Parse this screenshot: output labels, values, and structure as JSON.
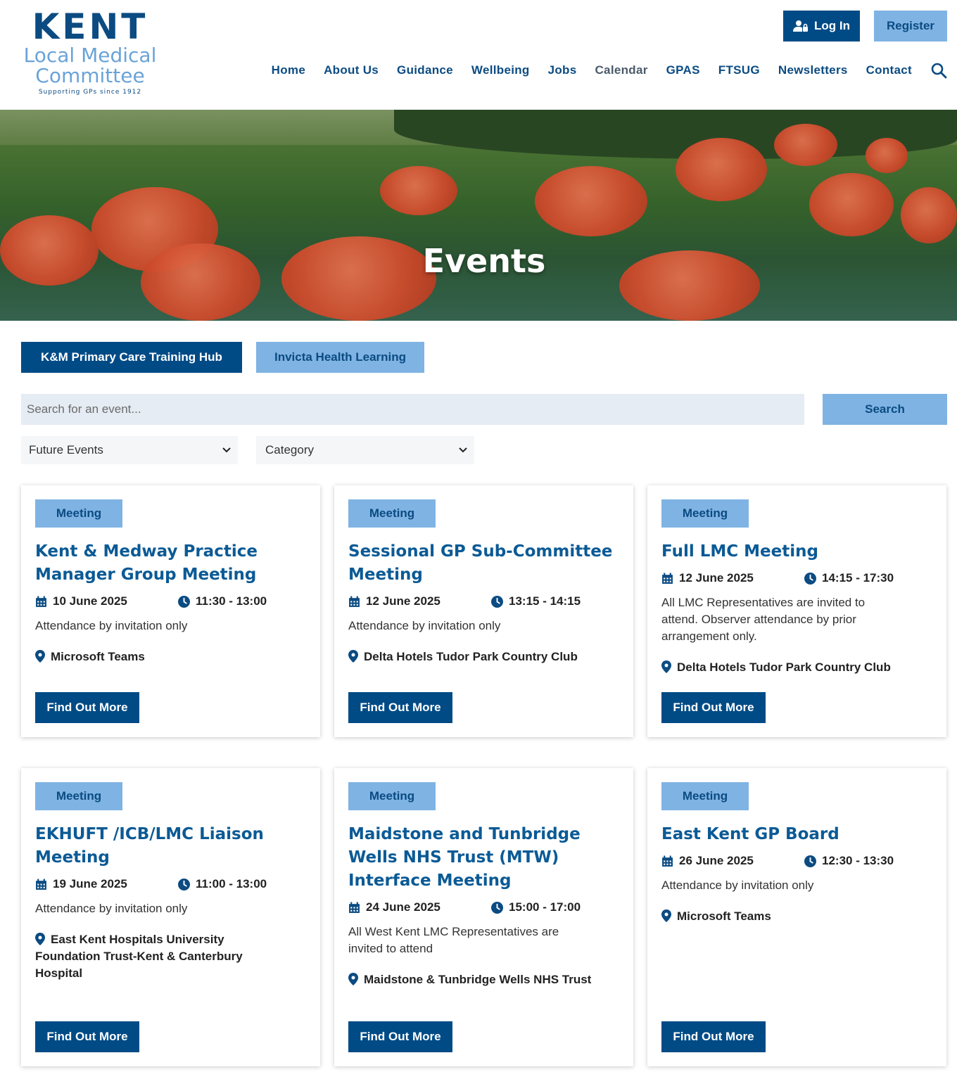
{
  "logo": {
    "line1": "KENT",
    "line2": "Local Medical",
    "line3": "Committee",
    "tagline": "Supporting GPs since 1912"
  },
  "header": {
    "login_label": "Log In",
    "register_label": "Register"
  },
  "nav": [
    "Home",
    "About Us",
    "Guidance",
    "Wellbeing",
    "Jobs",
    "Calendar",
    "GPAS",
    "FTSUG",
    "Newsletters",
    "Contact"
  ],
  "hero": {
    "title": "Events"
  },
  "filters": {
    "hub_label": "K&M Primary Care Training Hub",
    "invicta_label": "Invicta Health Learning",
    "search_placeholder": "Search for an event...",
    "search_button": "Search",
    "when_selected": "Future Events",
    "category_selected": "Category"
  },
  "colors": {
    "primary": "#004b86",
    "accent": "#7fb3e3",
    "title": "#0b5a95",
    "input_bg": "#e5ecf3"
  },
  "events": [
    {
      "category": "Meeting",
      "title": "Kent & Medway Practice Manager Group Meeting",
      "date": "10 June 2025",
      "time": "11:30 - 13:00",
      "description": "Attendance by invitation only",
      "location": "Microsoft Teams",
      "cta": "Find Out More"
    },
    {
      "category": "Meeting",
      "title": "Sessional GP Sub-Committee Meeting",
      "date": "12 June 2025",
      "time": "13:15 - 14:15",
      "description": "Attendance by invitation only",
      "location": "Delta Hotels Tudor Park Country Club",
      "cta": "Find Out More"
    },
    {
      "category": "Meeting",
      "title": "Full LMC Meeting",
      "date": "12 June 2025",
      "time": "14:15 - 17:30",
      "description": "All LMC Representatives are invited to attend. Observer attendance by prior arrangement only.",
      "location": "Delta Hotels Tudor Park Country Club",
      "cta": "Find Out More"
    },
    {
      "category": "Meeting",
      "title": "EKHUFT /ICB/LMC Liaison Meeting",
      "date": "19 June 2025",
      "time": "11:00 - 13:00",
      "description": "Attendance by invitation only",
      "location": "East Kent Hospitals University Foundation Trust-Kent & Canterbury Hospital",
      "cta": "Find Out More"
    },
    {
      "category": "Meeting",
      "title": "Maidstone and Tunbridge Wells NHS Trust (MTW) Interface Meeting",
      "date": "24 June 2025",
      "time": "15:00 - 17:00",
      "description": "All West Kent LMC Representatives are invited to attend",
      "location": "Maidstone & Tunbridge Wells NHS Trust",
      "cta": "Find Out More"
    },
    {
      "category": "Meeting",
      "title": "East Kent GP Board",
      "date": "26 June 2025",
      "time": "12:30 - 13:30",
      "description": "Attendance by invitation only",
      "location": "Microsoft Teams",
      "cta": "Find Out More"
    }
  ]
}
